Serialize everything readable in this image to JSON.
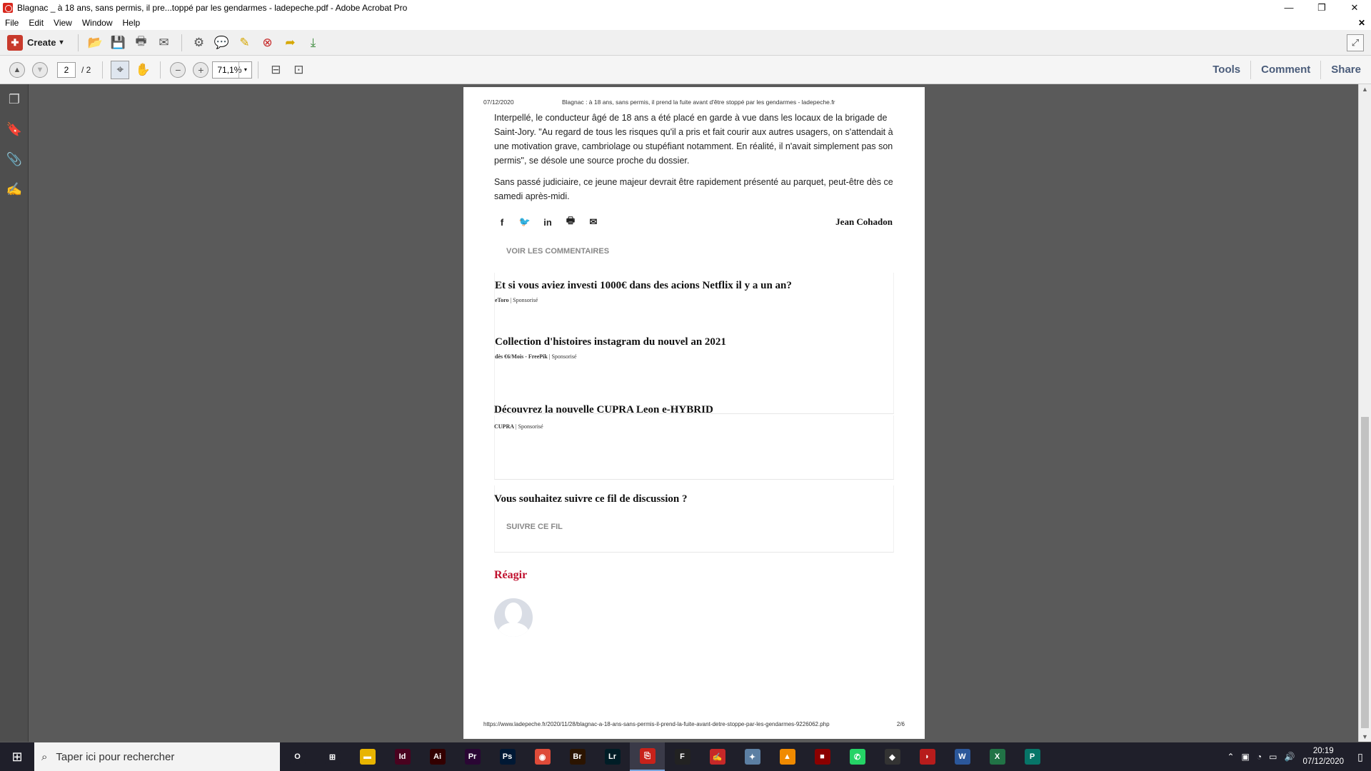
{
  "window": {
    "title": "Blagnac _ à 18 ans, sans permis, il pre...toppé par les gendarmes - ladepeche.pdf - Adobe Acrobat Pro",
    "minimize": "—",
    "restore": "❐",
    "close": "✕"
  },
  "menu": {
    "items": [
      "File",
      "Edit",
      "View",
      "Window",
      "Help"
    ],
    "close_doc": "✕"
  },
  "toolbar": {
    "create_label": "Create",
    "create_caret": "▾"
  },
  "nav": {
    "page_current": "2",
    "page_total": "/ 2",
    "zoom": "71,1%",
    "zoom_caret": "▾",
    "tools": "Tools",
    "comment": "Comment",
    "share": "Share"
  },
  "document": {
    "header_date": "07/12/2020",
    "header_title": "Blagnac : à 18 ans, sans permis, il prend la fuite avant d'être stoppé par les gendarmes - ladepeche.fr",
    "paragraph_1": "Interpellé, le conducteur âgé de 18 ans a été placé en garde à vue dans les locaux de la brigade de Saint-Jory. \"Au regard de tous les risques qu'il a pris et fait courir aux autres usagers, on s'attendait à une motivation grave, cambriolage ou stupéfiant notamment. En réalité, il n'avait simplement pas son permis\", se désole une source proche du dossier.",
    "paragraph_2": "Sans passé judiciaire, ce jeune majeur devrait être rapidement présenté au parquet, peut-être dès ce samedi après-midi.",
    "share_icons": [
      "f",
      "🐦",
      "in",
      "🖶",
      "✉"
    ],
    "author": "Jean Cohadon",
    "voir_commentaires": "VOIR LES COMMENTAIRES",
    "sponsored": [
      {
        "headline": "Et si vous aviez investi 1000€ dans des acions Netflix il y a un an?",
        "source": "eToro",
        "tag": " | Sponsorisé"
      },
      {
        "headline": "Collection d'histoires instagram du nouvel an 2021",
        "source": "dès €6/Mois - FreePik",
        "tag": " | Sponsorisé"
      },
      {
        "headline": "Découvrez la nouvelle CUPRA Leon e-HYBRID",
        "source": "CUPRA",
        "tag": " | Sponsorisé"
      }
    ],
    "suivre_title": "Vous souhaitez suivre ce fil de discussion ?",
    "suivre_link": "SUIVRE CE FIL",
    "reagir": "Réagir",
    "footer_url": "https://www.ladepeche.fr/2020/11/28/blagnac-a-18-ans-sans-permis-il-prend-la-fuite-avant-detre-stoppe-par-les-gendarmes-9226062.php",
    "footer_page": "2/6"
  },
  "taskbar": {
    "search_placeholder": "Taper ici pour rechercher",
    "apps": [
      {
        "label": "O",
        "color": "#1f1f2a",
        "name": "cortana-icon"
      },
      {
        "label": "⊞",
        "color": "#1f1f2a",
        "name": "task-view-icon"
      },
      {
        "label": "▬",
        "color": "#e8b400",
        "name": "file-explorer-icon"
      },
      {
        "label": "Id",
        "color": "#49021f",
        "name": "indesign-icon"
      },
      {
        "label": "Ai",
        "color": "#330000",
        "name": "illustrator-icon"
      },
      {
        "label": "Pr",
        "color": "#2a0634",
        "name": "premiere-icon"
      },
      {
        "label": "Ps",
        "color": "#001834",
        "name": "photoshop-icon"
      },
      {
        "label": "◉",
        "color": "#de4b39",
        "name": "chrome-icon"
      },
      {
        "label": "Br",
        "color": "#2b1400",
        "name": "bridge-icon"
      },
      {
        "label": "Lr",
        "color": "#001d26",
        "name": "lightroom-icon"
      },
      {
        "label": "⎘",
        "color": "#c8221a",
        "name": "acrobat-icon"
      },
      {
        "label": "F",
        "color": "#222222",
        "name": "fontforge-icon"
      },
      {
        "label": "✍",
        "color": "#c62828",
        "name": "signature-app-icon"
      },
      {
        "label": "✦",
        "color": "#5c7fa3",
        "name": "paint-app-icon"
      },
      {
        "label": "▲",
        "color": "#f08a00",
        "name": "vlc-icon"
      },
      {
        "label": "■",
        "color": "#8b0000",
        "name": "red-app-icon"
      },
      {
        "label": "✆",
        "color": "#25d366",
        "name": "whatsapp-icon"
      },
      {
        "label": "◆",
        "color": "#333333",
        "name": "diamond-app-icon"
      },
      {
        "label": "◗",
        "color": "#b71c1c",
        "name": "car-app-icon"
      },
      {
        "label": "W",
        "color": "#2b579a",
        "name": "word-icon"
      },
      {
        "label": "X",
        "color": "#217346",
        "name": "excel-icon"
      },
      {
        "label": "P",
        "color": "#077568",
        "name": "publisher-icon"
      }
    ],
    "time": "20:19",
    "date": "07/12/2020"
  }
}
